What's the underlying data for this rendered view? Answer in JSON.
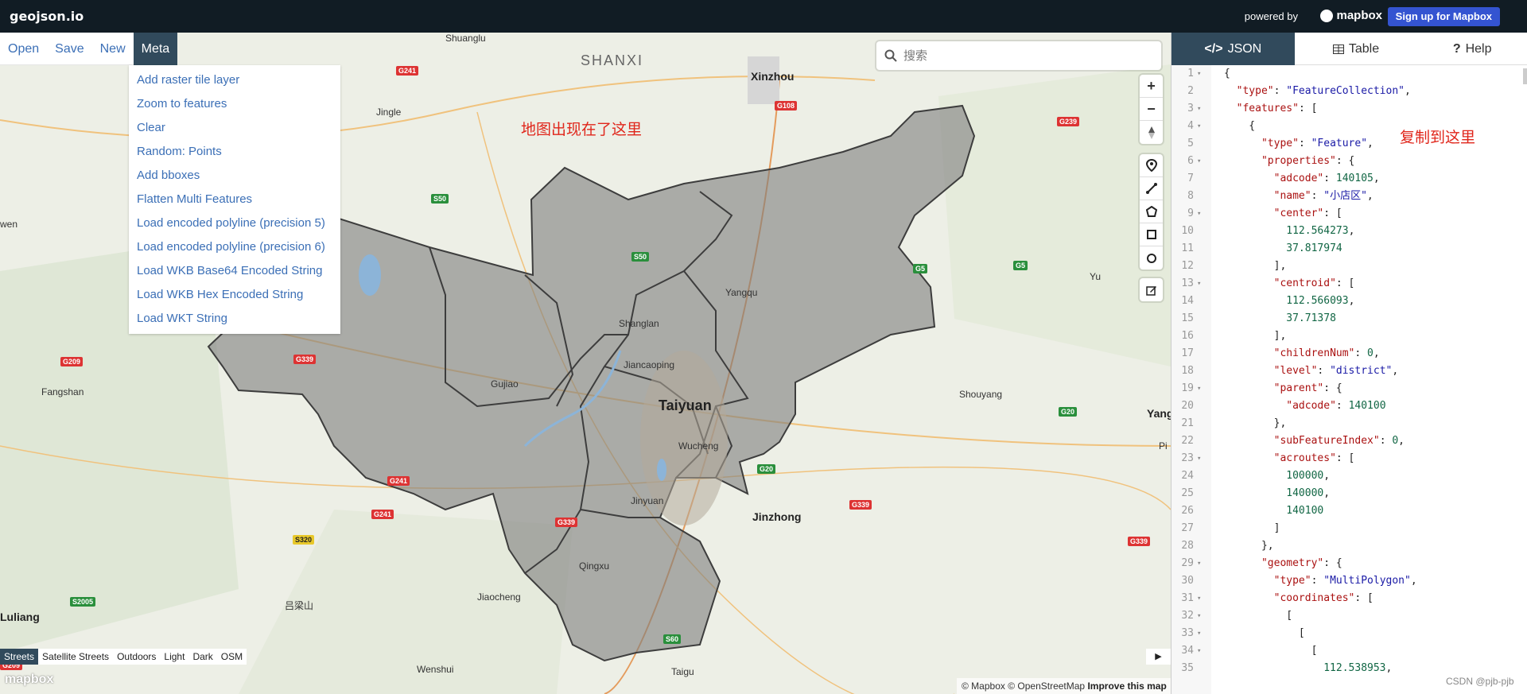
{
  "header": {
    "brand": "geojson.io",
    "powered_by": "powered by",
    "mapbox": "mapbox",
    "signup": "Sign up for Mapbox"
  },
  "menu": {
    "items": [
      "Open",
      "Save",
      "New",
      "Meta"
    ],
    "active": "Meta"
  },
  "dropdown": {
    "items": [
      "Add raster tile layer",
      "Zoom to features",
      "Clear",
      "Random: Points",
      "Add bboxes",
      "Flatten Multi Features",
      "Load encoded polyline (precision 5)",
      "Load encoded polyline (precision 6)",
      "Load WKB Base64 Encoded String",
      "Load WKB Hex Encoded String",
      "Load WKT String"
    ]
  },
  "search": {
    "placeholder": "搜索"
  },
  "annotations": {
    "map_note": "地图出现在了这里",
    "copy_note": "复制到这里"
  },
  "map_labels": {
    "province": "SHANXI",
    "capital": "Taiyuan",
    "places": [
      "Shuanglu",
      "Xinzhou",
      "Jingle",
      "Yangqu",
      "Gujiao",
      "Jiancaoping",
      "Wucheng",
      "Jinyuan",
      "Jinzhong",
      "Qingxu",
      "Jiaocheng",
      "Wenshui",
      "Taigu",
      "Shouyang",
      "Fangshan",
      "Yu",
      "Yang",
      "Pi",
      "Luliang",
      "吕梁山",
      "Shanglan",
      "wen"
    ],
    "roads": [
      "G241",
      "G108",
      "G239",
      "S50",
      "G5",
      "S50",
      "G5",
      "G209",
      "G339",
      "G241",
      "G241",
      "G20",
      "G339",
      "G339",
      "S320",
      "S2005",
      "G20",
      "S60",
      "G339",
      "G209"
    ]
  },
  "map_styles": {
    "items": [
      "Streets",
      "Satellite Streets",
      "Outdoors",
      "Light",
      "Dark",
      "OSM"
    ],
    "active": "Streets"
  },
  "watermark": "mapbox",
  "attribution": {
    "copy1": "© Mapbox",
    "copy2": "© OpenStreetMap",
    "improve": "Improve this map"
  },
  "tabs": {
    "items": [
      "JSON",
      "Table",
      "Help"
    ],
    "active": "JSON"
  },
  "editor": {
    "lines": [
      "{",
      "  \"type\": \"FeatureCollection\",",
      "  \"features\": [",
      "    {",
      "      \"type\": \"Feature\",",
      "      \"properties\": {",
      "        \"adcode\": 140105,",
      "        \"name\": \"小店区\",",
      "        \"center\": [",
      "          112.564273,",
      "          37.817974",
      "        ],",
      "        \"centroid\": [",
      "          112.566093,",
      "          37.71378",
      "        ],",
      "        \"childrenNum\": 0,",
      "        \"level\": \"district\",",
      "        \"parent\": {",
      "          \"adcode\": 140100",
      "        },",
      "        \"subFeatureIndex\": 0,",
      "        \"acroutes\": [",
      "          100000,",
      "          140000,",
      "          140100",
      "        ]",
      "      },",
      "      \"geometry\": {",
      "        \"type\": \"MultiPolygon\",",
      "        \"coordinates\": [",
      "          [",
      "            [",
      "              [",
      "                112.538953,"
    ],
    "foldable": [
      1,
      3,
      4,
      6,
      9,
      13,
      19,
      23,
      29,
      31,
      32,
      33,
      34
    ]
  },
  "credit": "CSDN @pjb-pjb"
}
